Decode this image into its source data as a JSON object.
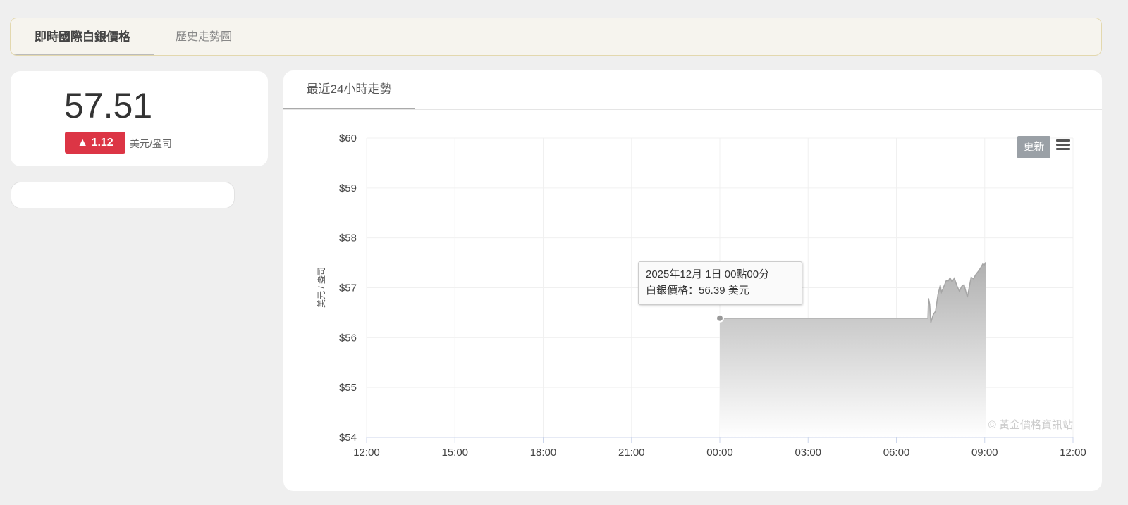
{
  "tabs": {
    "active": "即時國際白銀價格",
    "other": "歷史走勢圖"
  },
  "quote": {
    "price": "57.51",
    "change": "▲ 1.12",
    "unit": "美元/盎司",
    "change_color": "#dc3545"
  },
  "chart_tab": "最近24小時走勢",
  "controls": {
    "refresh": "更新",
    "menu_icon": "hamburger-menu-icon"
  },
  "tooltip": {
    "line1": "2025年12月 1日 00點00分",
    "line2": "白銀價格：56.39 美元"
  },
  "chart_data": {
    "type": "area",
    "title": "",
    "ylabel": "美元 / 盎司",
    "xlabel": "",
    "ylim": [
      54,
      60
    ],
    "yticks": [
      "$54",
      "$55",
      "$56",
      "$57",
      "$58",
      "$59",
      "$60"
    ],
    "xticks": [
      "12:00",
      "15:00",
      "18:00",
      "21:00",
      "00:00",
      "03:00",
      "06:00",
      "09:00",
      "12:00"
    ],
    "xrange_hours": [
      0,
      24
    ],
    "grid": true,
    "watermark": "© 黃金價格資訊站",
    "series": [
      {
        "name": "白銀價格",
        "points": [
          [
            12,
            56.39
          ],
          [
            19.07,
            56.39
          ],
          [
            19.09,
            56.79
          ],
          [
            19.13,
            56.67
          ],
          [
            19.17,
            56.3
          ],
          [
            19.25,
            56.46
          ],
          [
            19.33,
            56.53
          ],
          [
            19.41,
            56.86
          ],
          [
            19.49,
            57.05
          ],
          [
            19.53,
            56.91
          ],
          [
            19.58,
            56.98
          ],
          [
            19.69,
            57.14
          ],
          [
            19.77,
            57.14
          ],
          [
            19.82,
            57.2
          ],
          [
            19.89,
            57.12
          ],
          [
            19.97,
            57.19
          ],
          [
            20.05,
            57.05
          ],
          [
            20.14,
            56.93
          ],
          [
            20.22,
            57.03
          ],
          [
            20.3,
            57.06
          ],
          [
            20.41,
            56.81
          ],
          [
            20.54,
            57.21
          ],
          [
            20.62,
            57.18
          ],
          [
            20.69,
            57.26
          ],
          [
            20.81,
            57.35
          ],
          [
            20.86,
            57.4
          ],
          [
            20.94,
            57.48
          ],
          [
            20.99,
            57.46
          ],
          [
            21.03,
            57.51
          ]
        ]
      }
    ]
  }
}
